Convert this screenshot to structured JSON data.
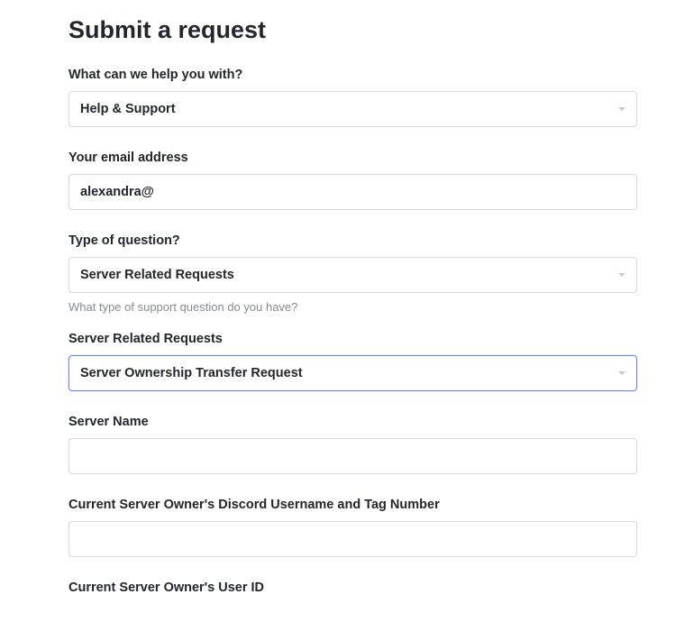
{
  "page": {
    "title": "Submit a request"
  },
  "fields": {
    "help_with": {
      "label": "What can we help you with?",
      "value": "Help & Support"
    },
    "email": {
      "label": "Your email address",
      "value": "alexandra@"
    },
    "question_type": {
      "label": "Type of question?",
      "value": "Server Related Requests",
      "help": "What type of support question do you have?"
    },
    "server_requests": {
      "label": "Server Related Requests",
      "value": "Server Ownership Transfer Request"
    },
    "server_name": {
      "label": "Server Name",
      "value": ""
    },
    "owner_username": {
      "label": "Current Server Owner's Discord Username and Tag Number",
      "value": ""
    },
    "owner_userid": {
      "label": "Current Server Owner's User ID",
      "value": ""
    }
  }
}
